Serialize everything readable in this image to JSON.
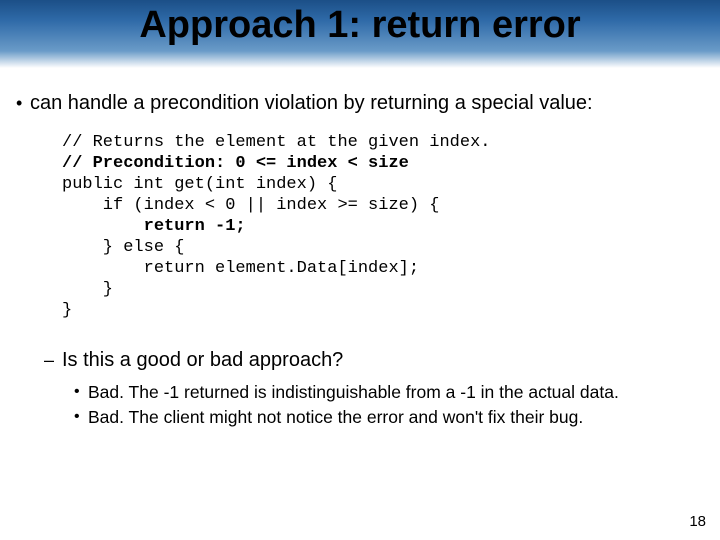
{
  "title": "Approach 1: return error",
  "bullet1": "can handle a precondition violation by returning a special value:",
  "code": {
    "l1": "// Returns the element at the given index.",
    "l2": "// Precondition: 0 <= index < size",
    "l3": "public int get(int index) {",
    "l4": "    if (index < 0 || index >= size) {",
    "l5": "        return -1;",
    "l6": "    } else {",
    "l7": "        return element.Data[index];",
    "l8": "    }",
    "l9": "}"
  },
  "question": "Is this a good or bad approach?",
  "answers": {
    "a1": "Bad.  The -1 returned is indistinguishable from a -1 in the actual data.",
    "a2": "Bad.  The client might not notice the error and won't fix their bug."
  },
  "page": "18"
}
